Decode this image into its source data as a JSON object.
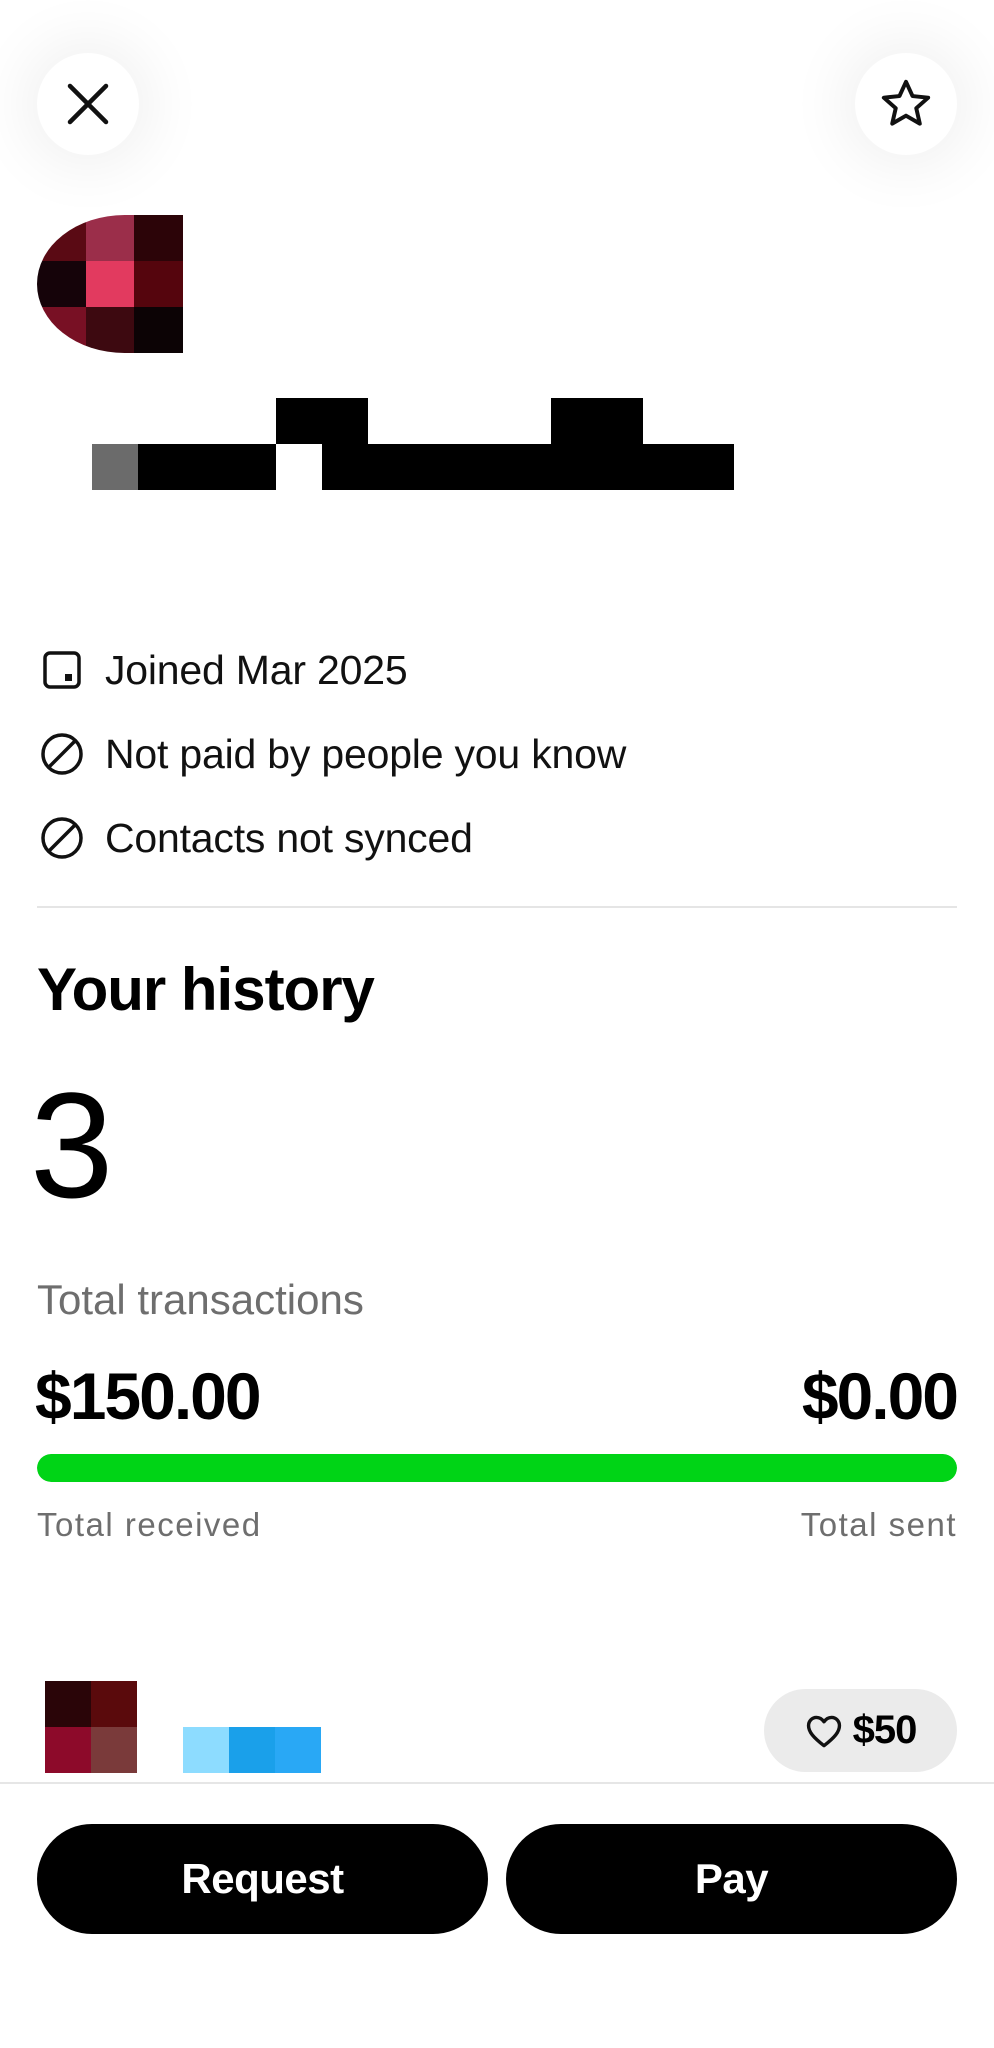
{
  "header": {
    "close_icon": "close-icon",
    "favorite_icon": "star-icon"
  },
  "profile": {
    "avatar_colors": [
      "#5a0a14",
      "#9b2e4a",
      "#2c0408",
      "#150309",
      "#e23a5f",
      "#55050d",
      "#781024",
      "#3d0910",
      "#0c0305"
    ],
    "name_redacted": true
  },
  "info": {
    "joined": "Joined Mar 2025",
    "not_paid": "Not paid by people you know",
    "contacts": "Contacts not synced"
  },
  "history": {
    "title": "Your history",
    "count": "3",
    "count_label": "Total transactions",
    "received_amount": "$150.00",
    "sent_amount": "$0.00",
    "received_fraction": 1.0,
    "bar_color": "#00d416",
    "received_label": "Total received",
    "sent_label": "Total sent"
  },
  "transaction": {
    "avatar_colors": [
      "#2a0508",
      "#5a0a0c",
      "#8d0a2a",
      "#7a3a3a"
    ],
    "name_colors": [
      "#8ddcff",
      "#1aa0ea",
      "#29a8f5"
    ],
    "like_amount": "$50",
    "like_icon": "heart-icon"
  },
  "actions": {
    "request_label": "Request",
    "pay_label": "Pay"
  }
}
